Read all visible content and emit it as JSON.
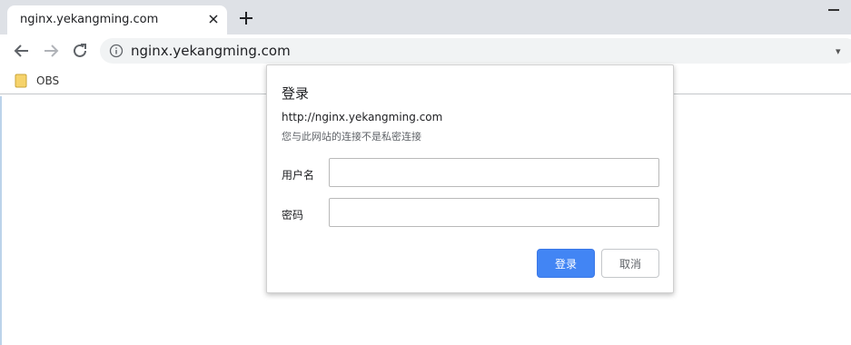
{
  "tab": {
    "title": "nginx.yekangming.com"
  },
  "toolbar": {
    "url": "nginx.yekangming.com"
  },
  "bookmarks": [
    {
      "label": "OBS"
    }
  ],
  "dialog": {
    "title": "登录",
    "url": "http://nginx.yekangming.com",
    "warning": "您与此网站的连接不是私密连接",
    "username_label": "用户名",
    "password_label": "密码",
    "username_value": "",
    "password_value": "",
    "login_button": "登录",
    "cancel_button": "取消"
  },
  "colors": {
    "accent": "#4285f4",
    "tabstrip": "#dee1e6",
    "omnibox": "#f1f3f4"
  }
}
